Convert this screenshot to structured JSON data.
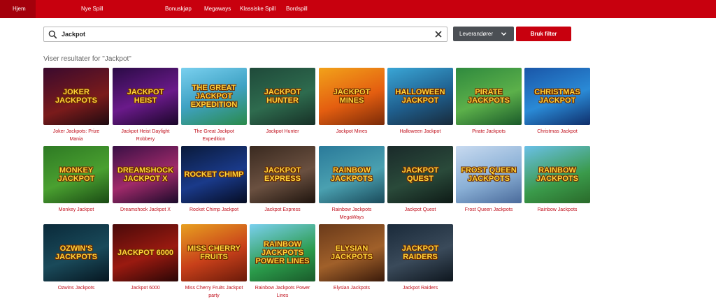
{
  "nav": {
    "items": [
      "Hjem",
      "Nye Spill",
      "Bonuskjøp",
      "Megaways",
      "Klassiske Spill",
      "Bordspill"
    ],
    "active": "Hjem"
  },
  "search": {
    "value": "Jackpot",
    "icon": "search-icon",
    "clear_icon": "close-icon"
  },
  "filters": {
    "provider_label": "Leverandører",
    "apply_label": "Bruk filter"
  },
  "results_label": "Viser resultater for \"Jackpot\"",
  "colors": {
    "brand_red": "#c8000e",
    "dark_button": "#4b4f54",
    "caption_red": "#c0101c"
  },
  "games": [
    {
      "caption": "Joker Jackpots: Prize Mania",
      "thumb_text": "Joker Jackpots",
      "bg": "linear-gradient(160deg,#3a0a2e,#7a1b1b 60%,#1d0a10)"
    },
    {
      "caption": "Jackpot Heist Daylight Robbery",
      "thumb_text": "Jackpot Heist",
      "bg": "linear-gradient(160deg,#2a0b45,#6a1a8a 55%,#1a0628)"
    },
    {
      "caption": "The Great Jackpot Expedition",
      "thumb_text": "The Great Jackpot Expedition",
      "bg": "linear-gradient(160deg,#7ad0ef,#3fa2c4 50%,#2a8a4a)"
    },
    {
      "caption": "Jackpot Hunter",
      "thumb_text": "Jackpot Hunter",
      "bg": "linear-gradient(160deg,#1f4a3a,#2e6b4e 55%,#173026)"
    },
    {
      "caption": "Jackpot Mines",
      "thumb_text": "Jackpot Mines",
      "bg": "linear-gradient(160deg,#f2a21a,#e45e10 55%,#7a2a08)"
    },
    {
      "caption": "Halloween Jackpot",
      "thumb_text": "Halloween Jackpot",
      "bg": "linear-gradient(160deg,#3aa6d6,#1f5f8e 55%,#182a3a)"
    },
    {
      "caption": "Pirate Jackpots",
      "thumb_text": "Pirate Jackpots",
      "bg": "linear-gradient(160deg,#2f8a3e,#5cb04a 55%,#1a5a2a)"
    },
    {
      "caption": "Christmas Jackpot",
      "thumb_text": "Christmas Jackpot",
      "bg": "linear-gradient(160deg,#1a56a8,#2a8ad6 55%,#0f2e6a)"
    },
    {
      "caption": "Monkey Jackpot",
      "thumb_text": "Monkey Jackpot",
      "bg": "linear-gradient(160deg,#2e7a24,#4aa030 55%,#1a4a14)"
    },
    {
      "caption": "Dreamshock Jackpot X",
      "thumb_text": "Dreamshock Jackpot X",
      "bg": "linear-gradient(160deg,#3a1046,#a02a6a 55%,#1a0a2a)"
    },
    {
      "caption": "Rocket Chimp Jackpot",
      "thumb_text": "Rocket Chimp",
      "bg": "linear-gradient(160deg,#0a1a3a,#1a3a8a 55%,#050c22)"
    },
    {
      "caption": "Jackpot Express",
      "thumb_text": "Jackpot Express",
      "bg": "linear-gradient(160deg,#3a2a20,#6a5040 55%,#1e140e)"
    },
    {
      "caption": "Rainbow Jackpots MegaWays",
      "thumb_text": "Rainbow Jackpots",
      "bg": "linear-gradient(160deg,#2a7a9a,#4aa0b0 55%,#1a4a5a)"
    },
    {
      "caption": "Jackpot Quest",
      "thumb_text": "Jackpot Quest",
      "bg": "linear-gradient(160deg,#1a2a2a,#2a4a3a 55%,#0e1a16)"
    },
    {
      "caption": "Frost Queen Jackpots",
      "thumb_text": "Frost Queen Jackpots",
      "bg": "linear-gradient(160deg,#c8daf0,#8ab0d6 55%,#4a6a9a)"
    },
    {
      "caption": "Rainbow Jackpots",
      "thumb_text": "Rainbow Jackpots",
      "bg": "linear-gradient(160deg,#6ac0e8,#3a9a4a 60%,#2a6a2a)"
    },
    {
      "caption": "Ozwins Jackpots",
      "thumb_text": "Ozwin's Jackpots",
      "bg": "linear-gradient(160deg,#0a2a3a,#1a4a5a 55%,#061620)"
    },
    {
      "caption": "Jackpot 6000",
      "thumb_text": "Jackpot 6000",
      "bg": "linear-gradient(160deg,#4a0a0a,#9a1a10 55%,#2a0606)"
    },
    {
      "caption": "Miss Cherry Fruits Jackpot party",
      "thumb_text": "Miss Cherry Fruits",
      "bg": "linear-gradient(160deg,#e8a020,#c8401a 55%,#6a1a0a)"
    },
    {
      "caption": "Rainbow Jackpots Power Lines",
      "thumb_text": "Rainbow Jackpots Power Lines",
      "bg": "linear-gradient(160deg,#7ad0ef,#2a9a4a 60%,#1a5a2a)"
    },
    {
      "caption": "Elysian Jackpots",
      "thumb_text": "Elysian Jackpots",
      "bg": "linear-gradient(160deg,#6a3a1a,#a0602a 55%,#3a1a0a)"
    },
    {
      "caption": "Jackpot Raiders",
      "thumb_text": "Jackpot Raiders",
      "bg": "linear-gradient(160deg,#1a2a3a,#3a4a5a 55%,#0e161e)"
    }
  ]
}
